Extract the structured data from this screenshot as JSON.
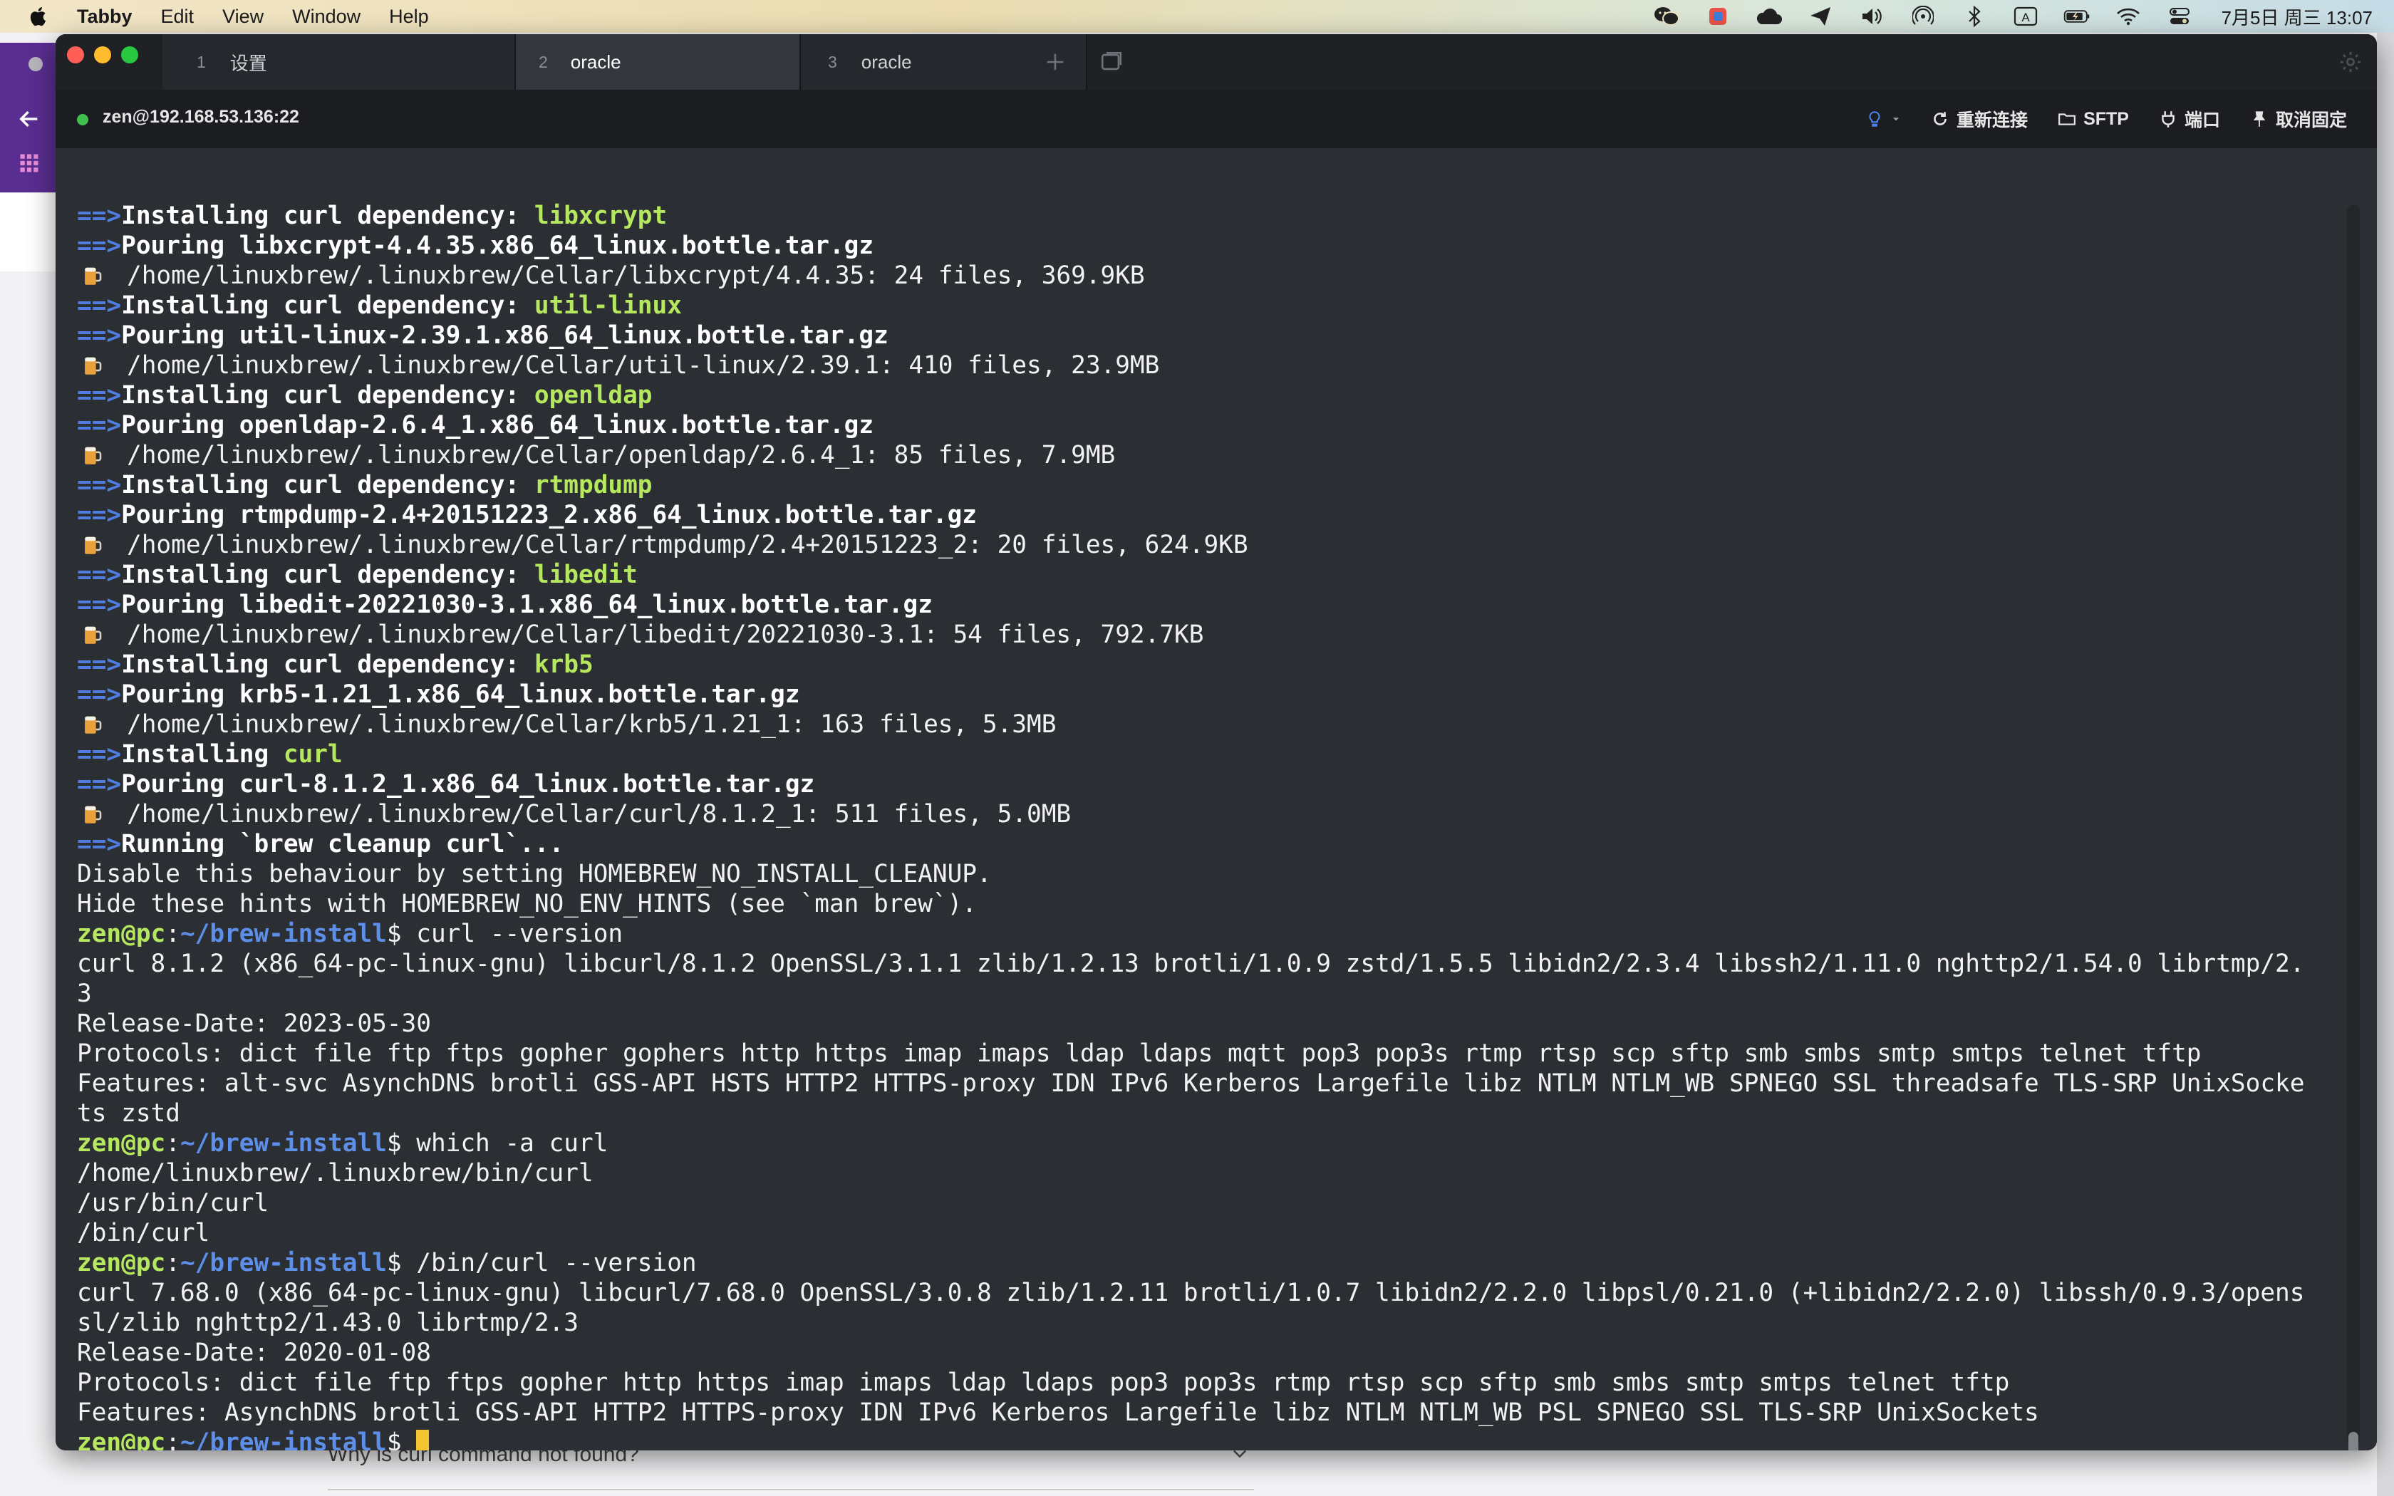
{
  "menubar": {
    "app": "Tabby",
    "items": [
      "Edit",
      "View",
      "Window",
      "Help"
    ],
    "clock": "7月5日 周三 13:07",
    "icons": [
      "wechat-icon",
      "app-icon",
      "cloud-icon",
      "send-icon",
      "volume-icon",
      "airdrop-icon",
      "bluetooth-icon",
      "input-method-icon",
      "battery-icon",
      "wifi-icon",
      "control-center-icon"
    ]
  },
  "tabs": [
    {
      "num": "1",
      "label": "设置"
    },
    {
      "num": "2",
      "label": "oracle"
    },
    {
      "num": "3",
      "label": "oracle"
    }
  ],
  "toolbar": {
    "connection": "zen@192.168.53.136:22",
    "reconnect": "重新连接",
    "sftp": "SFTP",
    "ports": "端口",
    "unpin": "取消固定"
  },
  "background": {
    "faq": "Why is curl command not found?"
  },
  "terminal": {
    "arrow": "==>",
    "lines": [
      {
        "type": "install",
        "text": "Installing curl dependency: ",
        "hl": "libxcrypt"
      },
      {
        "type": "pour",
        "text": "Pouring libxcrypt-4.4.35.x86_64_linux.bottle.tar.gz"
      },
      {
        "type": "beer",
        "text": "/home/linuxbrew/.linuxbrew/Cellar/libxcrypt/4.4.35: 24 files, 369.9KB"
      },
      {
        "type": "install",
        "text": "Installing curl dependency: ",
        "hl": "util-linux"
      },
      {
        "type": "pour",
        "text": "Pouring util-linux-2.39.1.x86_64_linux.bottle.tar.gz"
      },
      {
        "type": "beer",
        "text": "/home/linuxbrew/.linuxbrew/Cellar/util-linux/2.39.1: 410 files, 23.9MB"
      },
      {
        "type": "install",
        "text": "Installing curl dependency: ",
        "hl": "openldap"
      },
      {
        "type": "pour",
        "text": "Pouring openldap-2.6.4_1.x86_64_linux.bottle.tar.gz"
      },
      {
        "type": "beer",
        "text": "/home/linuxbrew/.linuxbrew/Cellar/openldap/2.6.4_1: 85 files, 7.9MB"
      },
      {
        "type": "install",
        "text": "Installing curl dependency: ",
        "hl": "rtmpdump"
      },
      {
        "type": "pour",
        "text": "Pouring rtmpdump-2.4+20151223_2.x86_64_linux.bottle.tar.gz"
      },
      {
        "type": "beer",
        "text": "/home/linuxbrew/.linuxbrew/Cellar/rtmpdump/2.4+20151223_2: 20 files, 624.9KB"
      },
      {
        "type": "install",
        "text": "Installing curl dependency: ",
        "hl": "libedit"
      },
      {
        "type": "pour",
        "text": "Pouring libedit-20221030-3.1.x86_64_linux.bottle.tar.gz"
      },
      {
        "type": "beer",
        "text": "/home/linuxbrew/.linuxbrew/Cellar/libedit/20221030-3.1: 54 files, 792.7KB"
      },
      {
        "type": "install",
        "text": "Installing curl dependency: ",
        "hl": "krb5"
      },
      {
        "type": "pour",
        "text": "Pouring krb5-1.21_1.x86_64_linux.bottle.tar.gz"
      },
      {
        "type": "beer",
        "text": "/home/linuxbrew/.linuxbrew/Cellar/krb5/1.21_1: 163 files, 5.3MB"
      },
      {
        "type": "install",
        "text": "Installing ",
        "hl": "curl"
      },
      {
        "type": "pour",
        "text": "Pouring curl-8.1.2_1.x86_64_linux.bottle.tar.gz"
      },
      {
        "type": "beer",
        "text": "/home/linuxbrew/.linuxbrew/Cellar/curl/8.1.2_1: 511 files, 5.0MB"
      },
      {
        "type": "pour",
        "text": "Running `brew cleanup curl`..."
      },
      {
        "type": "plain",
        "text": "Disable this behaviour by setting HOMEBREW_NO_INSTALL_CLEANUP."
      },
      {
        "type": "plain",
        "text": "Hide these hints with HOMEBREW_NO_ENV_HINTS (see `man brew`)."
      },
      {
        "type": "prompt",
        "user": "zen@pc",
        "path": "~/brew-install",
        "cmd": "$ curl --version"
      },
      {
        "type": "plain",
        "text": "curl 8.1.2 (x86_64-pc-linux-gnu) libcurl/8.1.2 OpenSSL/3.1.1 zlib/1.2.13 brotli/1.0.9 zstd/1.5.5 libidn2/2.3.4 libssh2/1.11.0 nghttp2/1.54.0 librtmp/2."
      },
      {
        "type": "plain",
        "text": "3"
      },
      {
        "type": "plain",
        "text": "Release-Date: 2023-05-30"
      },
      {
        "type": "plain",
        "text": "Protocols: dict file ftp ftps gopher gophers http https imap imaps ldap ldaps mqtt pop3 pop3s rtmp rtsp scp sftp smb smbs smtp smtps telnet tftp"
      },
      {
        "type": "plain",
        "text": "Features: alt-svc AsynchDNS brotli GSS-API HSTS HTTP2 HTTPS-proxy IDN IPv6 Kerberos Largefile libz NTLM NTLM_WB SPNEGO SSL threadsafe TLS-SRP UnixSocke"
      },
      {
        "type": "plain",
        "text": "ts zstd"
      },
      {
        "type": "prompt",
        "user": "zen@pc",
        "path": "~/brew-install",
        "cmd": "$ which -a curl"
      },
      {
        "type": "plain",
        "text": "/home/linuxbrew/.linuxbrew/bin/curl"
      },
      {
        "type": "plain",
        "text": "/usr/bin/curl"
      },
      {
        "type": "plain",
        "text": "/bin/curl"
      },
      {
        "type": "prompt",
        "user": "zen@pc",
        "path": "~/brew-install",
        "cmd": "$ /bin/curl --version"
      },
      {
        "type": "plain",
        "text": "curl 7.68.0 (x86_64-pc-linux-gnu) libcurl/7.68.0 OpenSSL/3.0.8 zlib/1.2.11 brotli/1.0.7 libidn2/2.2.0 libpsl/0.21.0 (+libidn2/2.2.0) libssh/0.9.3/opens"
      },
      {
        "type": "plain",
        "text": "sl/zlib nghttp2/1.43.0 librtmp/2.3"
      },
      {
        "type": "plain",
        "text": "Release-Date: 2020-01-08"
      },
      {
        "type": "plain",
        "text": "Protocols: dict file ftp ftps gopher http https imap imaps ldap ldaps pop3 pop3s rtmp rtsp scp sftp smb smbs smtp smtps telnet tftp"
      },
      {
        "type": "plain",
        "text": "Features: AsynchDNS brotli GSS-API HTTP2 HTTPS-proxy IDN IPv6 Kerberos Largefile libz NTLM NTLM_WB PSL SPNEGO SSL TLS-SRP UnixSockets"
      },
      {
        "type": "prompt-cursor",
        "user": "zen@pc",
        "path": "~/brew-install",
        "cmd": "$"
      }
    ]
  }
}
